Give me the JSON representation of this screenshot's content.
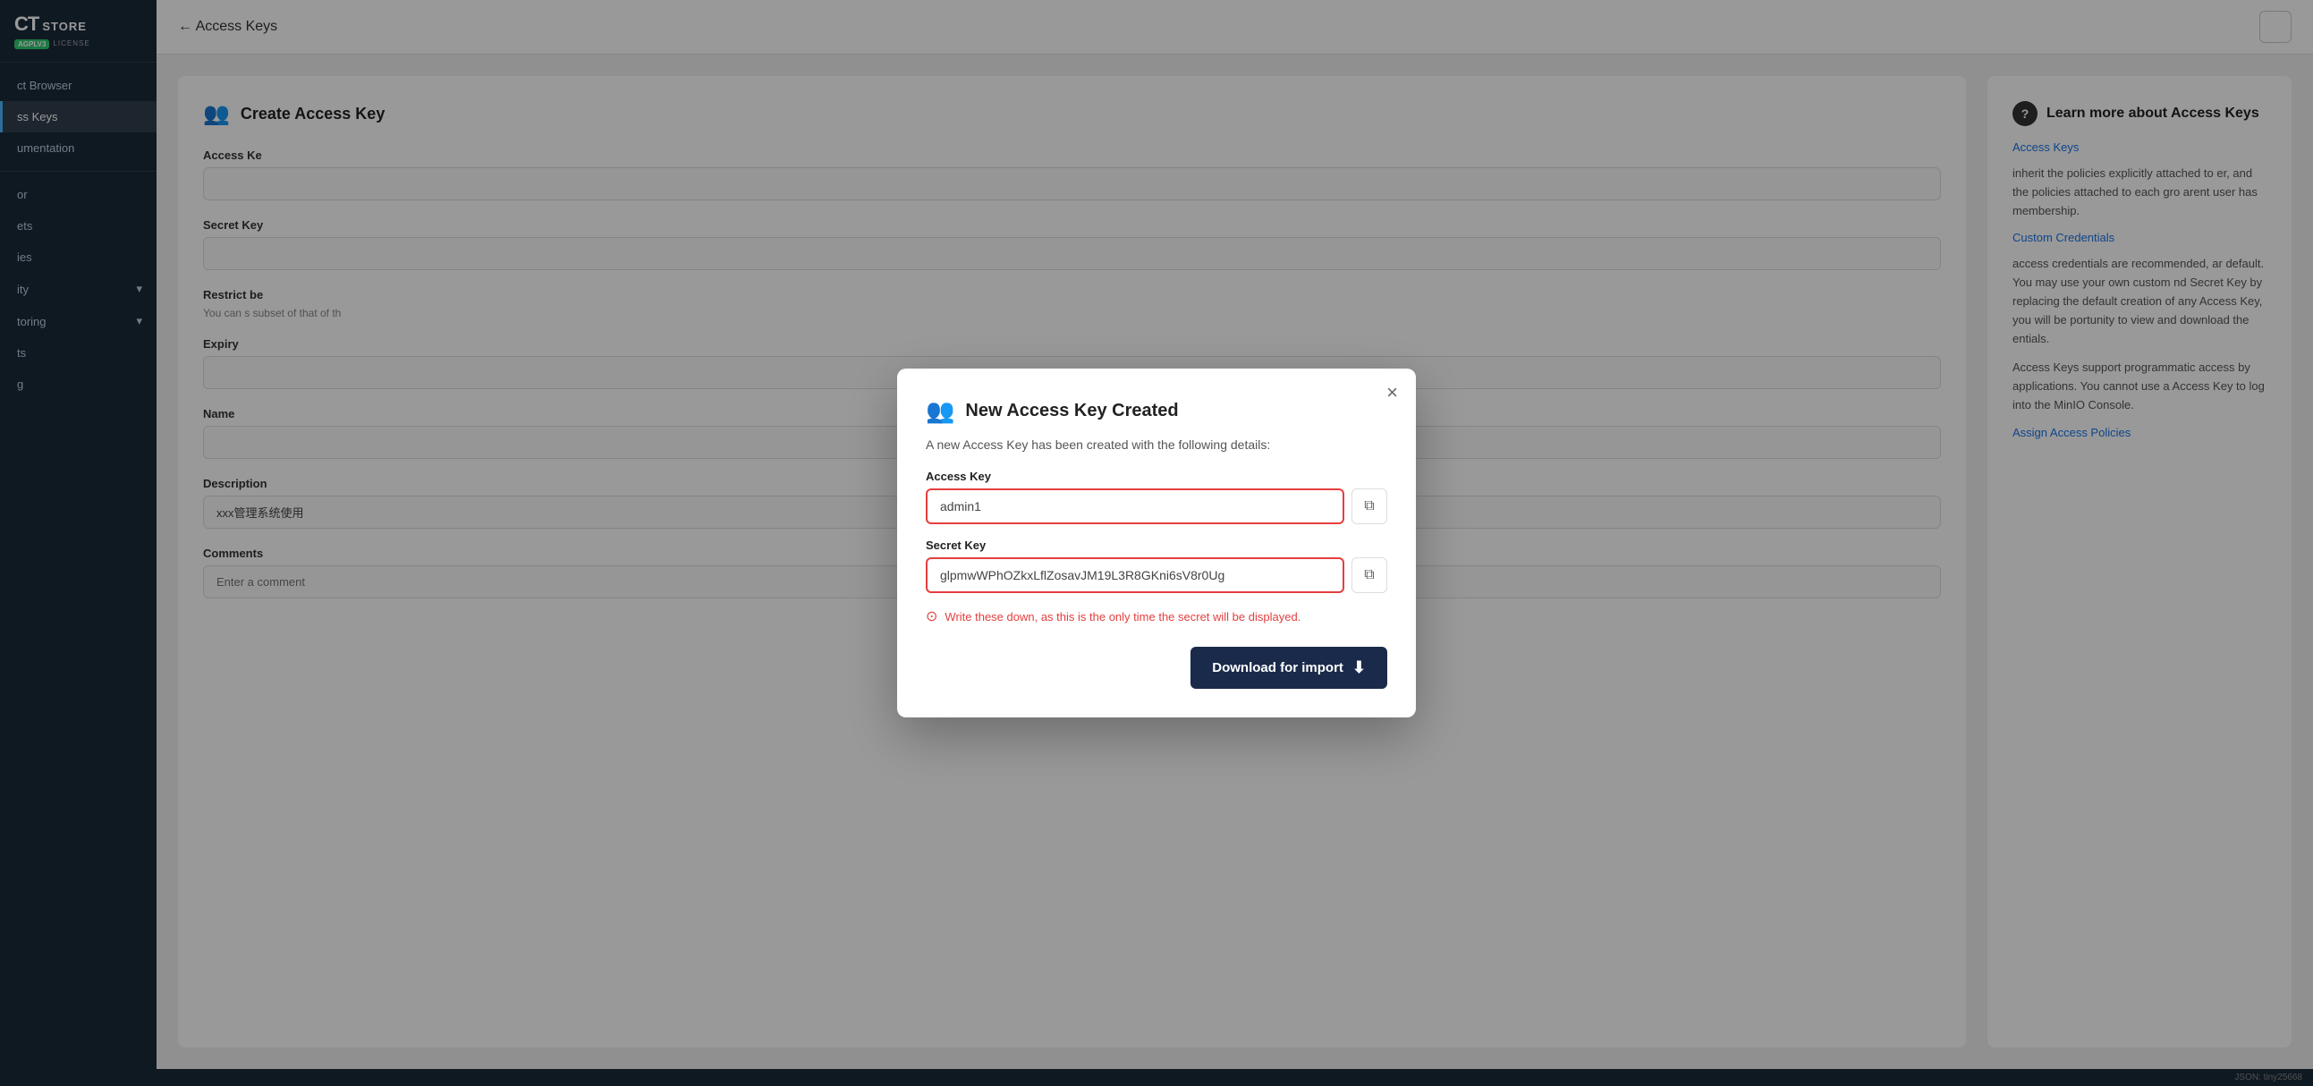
{
  "sidebar": {
    "logo": {
      "ct": "CT",
      "store": "STORE",
      "badge": "AGPLV3",
      "license": "LICENSE"
    },
    "items": [
      {
        "id": "product-browser",
        "label": "ct Browser",
        "active": false,
        "arrow": false
      },
      {
        "id": "access-keys",
        "label": "ss Keys",
        "active": true,
        "arrow": false
      },
      {
        "id": "documentation",
        "label": "umentation",
        "active": false,
        "arrow": false
      },
      {
        "id": "or",
        "label": "or",
        "active": false,
        "arrow": false
      },
      {
        "id": "ets",
        "label": "ets",
        "active": false,
        "arrow": false
      },
      {
        "id": "ies",
        "label": "ies",
        "active": false,
        "arrow": false
      },
      {
        "id": "ity",
        "label": "ity",
        "active": false,
        "arrow": true
      },
      {
        "id": "toring",
        "label": "toring",
        "active": false,
        "arrow": true
      },
      {
        "id": "ts",
        "label": "ts",
        "active": false,
        "arrow": false
      },
      {
        "id": "g",
        "label": "g",
        "active": false,
        "arrow": false
      }
    ]
  },
  "topbar": {
    "back_label": "← Access Keys",
    "title": "Access Keys"
  },
  "left_panel": {
    "icon": "👥",
    "title": "Create Access Key",
    "fields": [
      {
        "label": "Access Ke",
        "placeholder": ""
      },
      {
        "label": "Secret Key",
        "placeholder": ""
      },
      {
        "label": "Restrict be",
        "help": "You can s subset of that of th"
      },
      {
        "label": "Expiry",
        "placeholder": ""
      },
      {
        "label": "Name",
        "placeholder": ""
      },
      {
        "label": "Description",
        "value": "xxx管理系统使用"
      },
      {
        "label": "Comments",
        "placeholder": "Enter a comment"
      }
    ]
  },
  "right_panel": {
    "title": "Learn more about Access Keys",
    "icon": "?",
    "sections": [
      {
        "link": "Access Keys",
        "text": "inherit the policies explicitly attached to er, and the policies attached to each gro arent user has membership."
      },
      {
        "link": "Custom Credentials",
        "text": "access credentials are recommended, ar default. You may use your own custom nd Secret Key by replacing the default creation of any Access Key, you will be portunity to view and download the entials."
      },
      {
        "text": "Access Keys support programmatic access by applications. You cannot use a Access Key to log into the MinIO Console."
      },
      {
        "link": "Assign Access Policies"
      }
    ]
  },
  "modal": {
    "title": "New Access Key Created",
    "icon": "👥",
    "subtitle": "A new Access Key has been created with the following details:",
    "access_key_label": "Access Key",
    "access_key_value": "admin1",
    "secret_key_label": "Secret Key",
    "secret_key_value": "glpmwWPhOZkxLflZosavJM19L3R8GKni6sV8r0Ug",
    "warning": "Write these down, as this is the only time the secret will be displayed.",
    "download_button": "Download for import",
    "close_label": "×"
  },
  "statusbar": {
    "text": "JSON: tiny25668"
  }
}
